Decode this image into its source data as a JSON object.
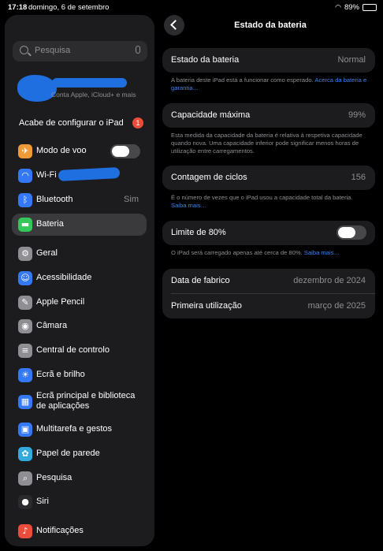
{
  "status_bar": {
    "time": "17:18",
    "date": "domingo, 6 de setembro",
    "battery_percent": "89%",
    "battery_level": 0.89
  },
  "sidebar": {
    "search_placeholder": "Pesquisa",
    "account_subtitle": "Conta Apple, iCloud+ e mais",
    "finish_setup_label": "Acabe de configurar o iPad",
    "finish_setup_badge": "1",
    "items": [
      {
        "label": "Modo de voo",
        "icon": "airplane-icon",
        "color": "#f09a37",
        "toggle": false
      },
      {
        "label": "Wi-Fi",
        "icon": "wifi-icon",
        "color": "#3478f6"
      },
      {
        "label": "Bluetooth",
        "icon": "bluetooth-icon",
        "color": "#3478f6",
        "value": "Sim"
      },
      {
        "label": "Bateria",
        "icon": "battery-icon",
        "color": "#34c759",
        "selected": true
      },
      {
        "label": "Geral",
        "icon": "gear-icon",
        "color": "#8e8e93"
      },
      {
        "label": "Acessibilidade",
        "icon": "accessibility-icon",
        "color": "#3478f6"
      },
      {
        "label": "Apple Pencil",
        "icon": "pencil-icon",
        "color": "#8e8e93"
      },
      {
        "label": "Câmara",
        "icon": "camera-icon",
        "color": "#8e8e93"
      },
      {
        "label": "Central de controlo",
        "icon": "control-center-icon",
        "color": "#8e8e93"
      },
      {
        "label": "Ecrã e brilho",
        "icon": "brightness-icon",
        "color": "#3478f6"
      },
      {
        "label": "Ecrã principal e biblioteca",
        "label2": "de aplicações",
        "icon": "home-screen-icon",
        "color": "#3478f6"
      },
      {
        "label": "Multitarefa e gestos",
        "icon": "multitasking-icon",
        "color": "#3478f6"
      },
      {
        "label": "Papel de parede",
        "icon": "wallpaper-icon",
        "color": "#33aadc"
      },
      {
        "label": "Pesquisa",
        "icon": "search-icon",
        "color": "#8e8e93"
      },
      {
        "label": "Siri",
        "icon": "siri-icon",
        "color": "#2a2a2e"
      },
      {
        "label": "Notificações",
        "icon": "bell-icon",
        "color": "#eb4d3d"
      }
    ]
  },
  "detail": {
    "title": "Estado da bateria",
    "health_label": "Estado da bateria",
    "health_value": "Normal",
    "health_note": "A bateria deste iPad está a funcionar como esperado.",
    "health_link": "Acerca da bateria e garantia…",
    "capacity_label": "Capacidade máxima",
    "capacity_value": "99%",
    "capacity_note": "Esta medida da capacidade da bateria é relativa à respetiva capacidade quando nova. Uma capacidade inferior pode significar menos horas de utilização entre carregamentos.",
    "cycles_label": "Contagem de ciclos",
    "cycles_value": "156",
    "cycles_note": "É o número de vezes que o iPad usou a capacidade total da bateria.",
    "cycles_link": "Saiba mais…",
    "limit_label": "Limite de 80%",
    "limit_enabled": false,
    "limit_note": "O iPad será carregado apenas até cerca de 80%.",
    "limit_link": "Saiba mais…",
    "manufacture_label": "Data de fabrico",
    "manufacture_value": "dezembro de 2024",
    "first_use_label": "Primeira utilização",
    "first_use_value": "março de 2025"
  }
}
